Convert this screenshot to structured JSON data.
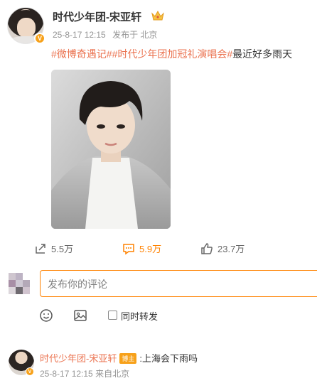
{
  "post": {
    "author": "时代少年团-宋亚轩",
    "verified_badge": "V",
    "time": "25-8-17 12:15",
    "source": "发布于 北京",
    "topics": [
      "#微博奇遇记#",
      "#时代少年团加冠礼演唱会#"
    ],
    "text": "最近好多雨天"
  },
  "actions": {
    "repost": "5.5万",
    "comment": "5.9万",
    "like": "23.7万"
  },
  "composer": {
    "placeholder": "发布你的评论",
    "repost_option": "同时转发"
  },
  "comment": {
    "author": "时代少年团-宋亚轩",
    "badge": "博主",
    "text": ":上海会下雨吗",
    "time": "25-8-17 12:15",
    "source": "来自北京"
  },
  "colors": {
    "accent": "#ff8200",
    "topic": "#eb7350",
    "meta": "#939393",
    "verified": "#f7a11a"
  }
}
